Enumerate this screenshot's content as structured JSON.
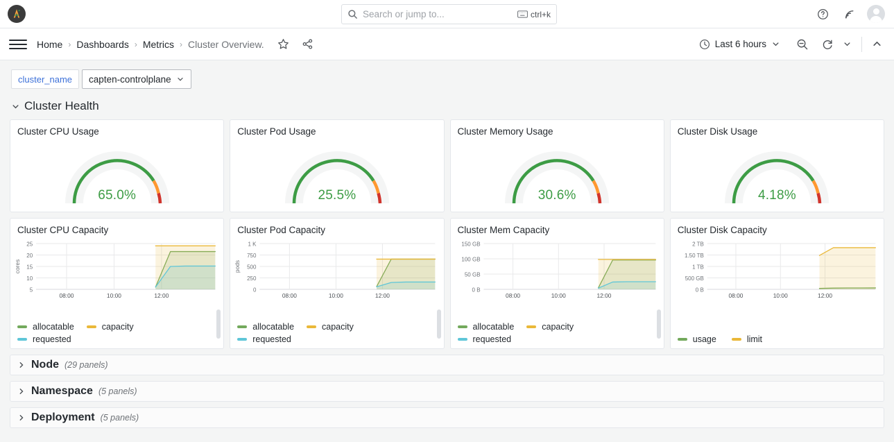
{
  "topbar": {
    "logo_name": "grafana-logo",
    "search": {
      "placeholder": "Search or jump to...",
      "value": "",
      "shortcut": "ctrl+k"
    },
    "help_icon": "help-circle-icon",
    "news_icon": "rss-news-icon",
    "avatar_icon": "user-avatar"
  },
  "nav": {
    "menu_icon": "hamburger-menu-icon",
    "breadcrumbs": [
      {
        "label": "Home",
        "current": false
      },
      {
        "label": "Dashboards",
        "current": false
      },
      {
        "label": "Metrics",
        "current": false
      },
      {
        "label": "Cluster Overview.",
        "current": true
      }
    ],
    "star_icon": "star-favorite-icon",
    "share_icon": "share-nodes-icon",
    "time_range": "Last 6 hours",
    "clock_icon": "clock-icon",
    "time_chevron_icon": "chevron-down-icon",
    "zoom_out_icon": "zoom-out-magnifier-icon",
    "refresh_icon": "refresh-circular-arrow-icon",
    "refresh_chevron_icon": "chevron-down-icon",
    "collapse_icon": "chevron-up-icon"
  },
  "variables": [
    {
      "name": "cluster_name",
      "value": "capten-controlplane",
      "chevron_icon": "chevron-down-icon"
    }
  ],
  "row": {
    "title": "Cluster Health",
    "expanded": true,
    "chevron_icon": "chevron-down-icon"
  },
  "colors": {
    "green": "#3d9c45",
    "orange": "#ff9830",
    "red": "#d0342c",
    "track": "#f4f5f5",
    "legend_green": "#73a95c",
    "legend_yellow": "#eab839",
    "legend_cyan": "#5fc6d8",
    "text": "#24292e",
    "muted": "#6e7277",
    "panel_bg": "#ffffff",
    "page_bg": "#f4f5f5",
    "link_blue": "#3d71d9"
  },
  "gauges": [
    {
      "title": "Cluster CPU Usage",
      "value": "65.0%",
      "value_num": 65.0,
      "min": 0,
      "max": 100,
      "unit": "percent"
    },
    {
      "title": "Cluster Pod Usage",
      "value": "25.5%",
      "value_num": 25.5,
      "min": 0,
      "max": 100,
      "unit": "percent"
    },
    {
      "title": "Cluster Memory Usage",
      "value": "30.6%",
      "value_num": 30.6,
      "min": 0,
      "max": 100,
      "unit": "percent"
    },
    {
      "title": "Cluster Disk Usage",
      "value": "4.18%",
      "value_num": 4.18,
      "min": 0,
      "max": 100,
      "unit": "percent"
    }
  ],
  "chart_data": [
    {
      "type": "area",
      "title": "Cluster CPU Capacity",
      "ylabel": "cores",
      "xlabel": "",
      "yticks": [
        "25",
        "20",
        "15",
        "10",
        "5"
      ],
      "ytick_values": [
        25,
        20,
        15,
        10,
        5
      ],
      "ylim": [
        5,
        25
      ],
      "xticks": [
        "08:00",
        "10:00",
        "12:00"
      ],
      "grid": true,
      "legend_position": "bottom",
      "series": [
        {
          "name": "allocatable",
          "color": "#73a95c",
          "values": [
            null,
            null,
            null,
            null,
            null,
            null,
            null,
            null,
            6,
            21.5,
            21.5,
            21.5,
            21.5
          ]
        },
        {
          "name": "capacity",
          "color": "#eab839",
          "values": [
            null,
            null,
            null,
            null,
            null,
            null,
            null,
            null,
            24,
            24,
            24,
            24,
            24
          ]
        },
        {
          "name": "requested",
          "color": "#5fc6d8",
          "values": [
            null,
            null,
            null,
            null,
            null,
            null,
            null,
            null,
            6,
            15,
            15.2,
            15.2,
            15.2
          ]
        }
      ]
    },
    {
      "type": "area",
      "title": "Cluster Pod Capacity",
      "ylabel": "pods",
      "xlabel": "",
      "yticks": [
        "1 K",
        "750",
        "500",
        "250",
        "0"
      ],
      "ytick_values": [
        1000,
        750,
        500,
        250,
        0
      ],
      "ylim": [
        0,
        1000
      ],
      "xticks": [
        "08:00",
        "10:00",
        "12:00"
      ],
      "grid": true,
      "legend_position": "bottom",
      "series": [
        {
          "name": "allocatable",
          "color": "#73a95c",
          "values": [
            null,
            null,
            null,
            null,
            null,
            null,
            null,
            null,
            60,
            660,
            660,
            660,
            660
          ]
        },
        {
          "name": "capacity",
          "color": "#eab839",
          "values": [
            null,
            null,
            null,
            null,
            null,
            null,
            null,
            null,
            660,
            660,
            660,
            660,
            660
          ]
        },
        {
          "name": "requested",
          "color": "#5fc6d8",
          "values": [
            null,
            null,
            null,
            null,
            null,
            null,
            null,
            null,
            55,
            150,
            160,
            160,
            160
          ]
        }
      ]
    },
    {
      "type": "area",
      "title": "Cluster Mem Capacity",
      "ylabel": "",
      "xlabel": "",
      "yticks": [
        "150 GB",
        "100 GB",
        "50 GB",
        "0 B"
      ],
      "ytick_values": [
        150,
        100,
        50,
        0
      ],
      "ylim": [
        0,
        150
      ],
      "xticks": [
        "08:00",
        "10:00",
        "12:00"
      ],
      "grid": true,
      "legend_position": "bottom",
      "series": [
        {
          "name": "allocatable",
          "color": "#73a95c",
          "values": [
            null,
            null,
            null,
            null,
            null,
            null,
            null,
            null,
            5,
            96,
            96,
            96,
            96
          ]
        },
        {
          "name": "capacity",
          "color": "#eab839",
          "values": [
            null,
            null,
            null,
            null,
            null,
            null,
            null,
            null,
            98,
            98,
            98,
            98,
            98
          ]
        },
        {
          "name": "requested",
          "color": "#5fc6d8",
          "values": [
            null,
            null,
            null,
            null,
            null,
            null,
            null,
            null,
            4,
            24,
            25,
            25,
            25
          ]
        }
      ]
    },
    {
      "type": "area",
      "title": "Cluster Disk Capacity",
      "ylabel": "",
      "xlabel": "",
      "yticks": [
        "2 TB",
        "1.50 TB",
        "1 TB",
        "500 GB",
        "0 B"
      ],
      "ytick_values": [
        2000,
        1500,
        1000,
        500,
        0
      ],
      "ylim": [
        0,
        2000
      ],
      "xticks": [
        "08:00",
        "10:00",
        "12:00"
      ],
      "grid": true,
      "legend_position": "bottom",
      "series": [
        {
          "name": "usage",
          "color": "#73a95c",
          "values": [
            null,
            null,
            null,
            null,
            null,
            null,
            null,
            null,
            40,
            55,
            60,
            60,
            62
          ]
        },
        {
          "name": "limit",
          "color": "#eab839",
          "values": [
            null,
            null,
            null,
            null,
            null,
            null,
            null,
            null,
            1480,
            1820,
            1820,
            1820,
            1820
          ]
        }
      ]
    }
  ],
  "collapsed_rows": [
    {
      "title": "Node",
      "count": "(29 panels)",
      "chevron_icon": "chevron-right-icon"
    },
    {
      "title": "Namespace",
      "count": "(5 panels)",
      "chevron_icon": "chevron-right-icon"
    },
    {
      "title": "Deployment",
      "count": "(5 panels)",
      "chevron_icon": "chevron-right-icon"
    }
  ]
}
